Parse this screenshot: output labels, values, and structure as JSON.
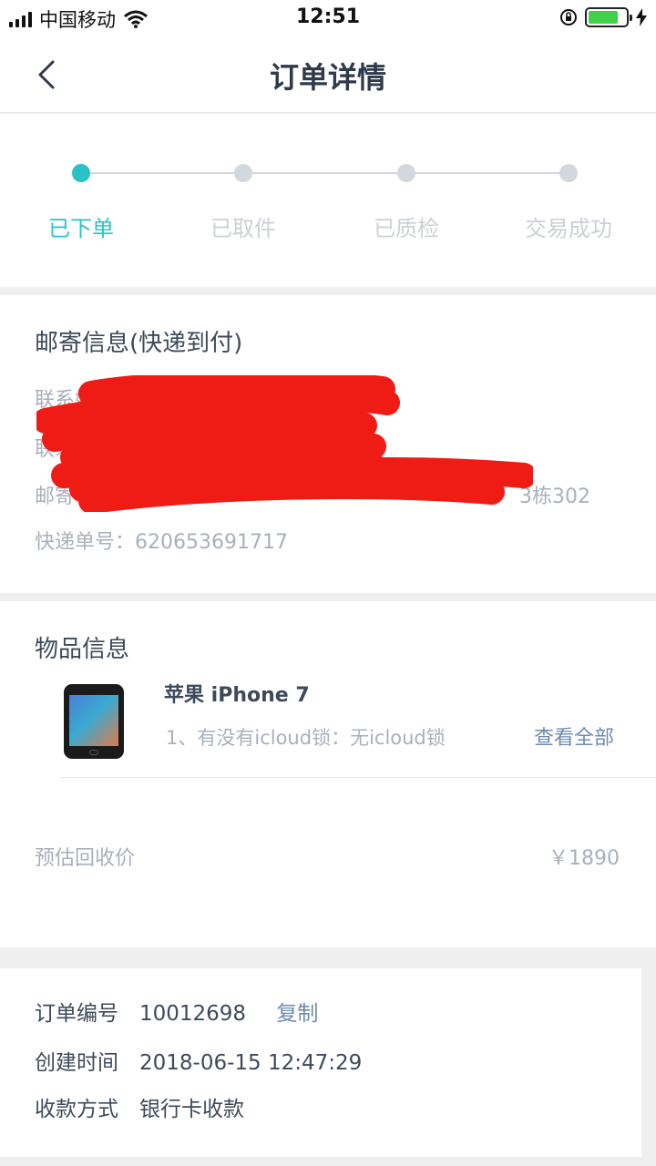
{
  "status_bar": {
    "carrier": "中国移动",
    "time": "12:51"
  },
  "nav": {
    "title": "订单详情"
  },
  "progress": {
    "steps": [
      {
        "label": "已下单",
        "active": true
      },
      {
        "label": "已取件",
        "active": false
      },
      {
        "label": "已质检",
        "active": false
      },
      {
        "label": "交易成功",
        "active": false
      }
    ],
    "accent_color": "#29c3c6"
  },
  "shipping": {
    "title": "邮寄信息(快递到付)",
    "contact_name_label": "联系姓名：",
    "contact_phone_label": "联系",
    "address_label": "邮寄地址",
    "address_tail": "3栋302",
    "tracking_label": "快递单号：",
    "tracking_number": "620653691717"
  },
  "items": {
    "title": "物品信息",
    "product_name": "苹果 iPhone 7",
    "product_spec": "1、有没有icloud锁：无icloud锁",
    "view_all": "查看全部",
    "estimate_label": "预估回收价",
    "estimate_price": "￥1890"
  },
  "order": {
    "number_label": "订单编号",
    "number_value": "10012698",
    "copy": "复制",
    "created_label": "创建时间",
    "created_value": "2018-06-15 12:47:29",
    "payment_label": "收款方式",
    "payment_value": "银行卡收款"
  }
}
